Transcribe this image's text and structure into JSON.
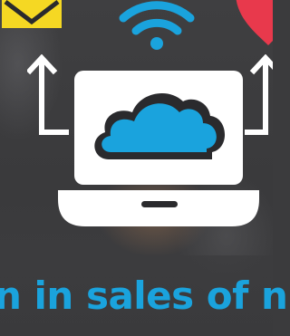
{
  "headline": "n in sales of n",
  "icons": {
    "mail": "mail-icon",
    "wifi": "wifi-icon",
    "heart": "heart-icon",
    "cloud_laptop": "cloud-laptop-icon",
    "arrow_left": "arrow-up-icon",
    "arrow_right": "arrow-up-icon"
  },
  "colors": {
    "accent_blue": "#1aa3dd",
    "mail_yellow": "#f5d823",
    "heart_red": "#e8394c",
    "outline_dark": "#2a2a2d",
    "white": "#ffffff"
  }
}
